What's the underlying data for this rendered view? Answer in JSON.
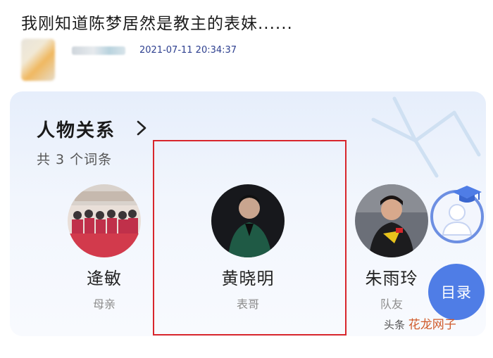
{
  "post": {
    "title": "我刚知道陈梦居然是教主的表妹......",
    "timestamp": "2021-07-11 20:34:37"
  },
  "relations": {
    "heading": "人物关系",
    "count_text": "共 3 个词条",
    "people": [
      {
        "name": "逄敏",
        "role": "母亲"
      },
      {
        "name": "黄晓明",
        "role": "表哥"
      },
      {
        "name": "朱雨玲",
        "role": "队友"
      }
    ]
  },
  "menu_button_label": "目录",
  "watermark": {
    "prefix": "头条",
    "logo": "花龙网子"
  },
  "colors": {
    "accent_blue": "#4f7de6",
    "highlight_red": "#d8262c",
    "timestamp_blue": "#2d3f8f"
  }
}
